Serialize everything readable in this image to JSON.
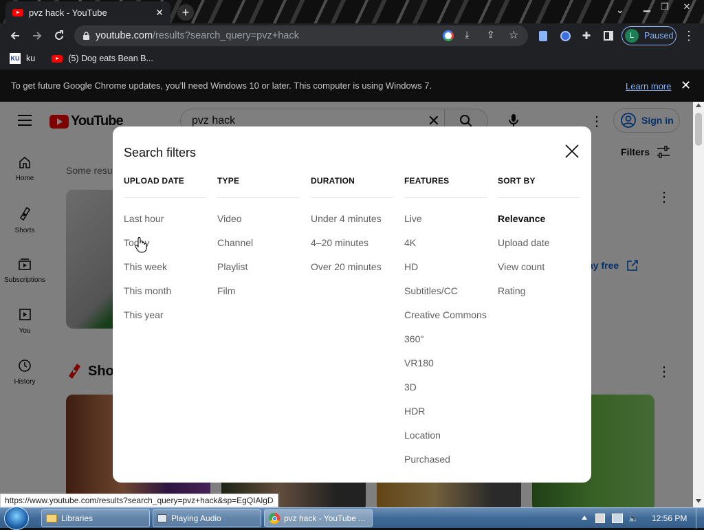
{
  "browser": {
    "tab_title": "pvz hack - YouTube",
    "url_host": "youtube.com",
    "url_path": "/results?search_query=pvz+hack",
    "profile_initial": "L",
    "profile_status": "Paused",
    "window_controls": [
      "minimize",
      "restore",
      "close"
    ]
  },
  "bookmarks": [
    {
      "label": "ku",
      "icon": "KU"
    },
    {
      "label": "(5) Dog eats Bean B...",
      "icon": "youtube-icon"
    }
  ],
  "infobar": {
    "message": "To get future Google Chrome updates, you'll need Windows 10 or later. This computer is using Windows 7.",
    "link": "Learn more"
  },
  "youtube": {
    "logo": "YouTube",
    "search_value": "pvz hack",
    "sign_in": "Sign in",
    "filters": "Filters",
    "some_results": "Some resu",
    "shorts_heading": "Sho",
    "play_free": "ay free",
    "sidenav": [
      {
        "label": "Home",
        "icon": "home-icon"
      },
      {
        "label": "Shorts",
        "icon": "shorts-icon"
      },
      {
        "label": "Subscriptions",
        "icon": "subscriptions-icon"
      },
      {
        "label": "You",
        "icon": "you-icon"
      },
      {
        "label": "History",
        "icon": "history-icon"
      }
    ]
  },
  "search_filters": {
    "title": "Search filters",
    "columns": [
      {
        "header": "UPLOAD DATE",
        "options": [
          "Last hour",
          "Today",
          "This week",
          "This month",
          "This year"
        ],
        "selected": null
      },
      {
        "header": "TYPE",
        "options": [
          "Video",
          "Channel",
          "Playlist",
          "Film"
        ],
        "selected": null
      },
      {
        "header": "DURATION",
        "options": [
          "Under 4 minutes",
          "4–20 minutes",
          "Over 20 minutes"
        ],
        "selected": null
      },
      {
        "header": "FEATURES",
        "options": [
          "Live",
          "4K",
          "HD",
          "Subtitles/CC",
          "Creative Commons",
          "360°",
          "VR180",
          "3D",
          "HDR",
          "Location",
          "Purchased"
        ],
        "selected": null
      },
      {
        "header": "SORT BY",
        "options": [
          "Relevance",
          "Upload date",
          "View count",
          "Rating"
        ],
        "selected": "Relevance"
      }
    ]
  },
  "status_url": "https://www.youtube.com/results?search_query=pvz+hack&sp=EgQIAlgD",
  "taskbar": {
    "tasks": [
      {
        "label": "Libraries",
        "icon": "folder-icon"
      },
      {
        "label": "Playing Audio",
        "icon": "audio-window-icon"
      },
      {
        "label": "pvz hack - YouTube ...",
        "icon": "chrome-icon"
      }
    ],
    "clock": "12:56 PM"
  }
}
